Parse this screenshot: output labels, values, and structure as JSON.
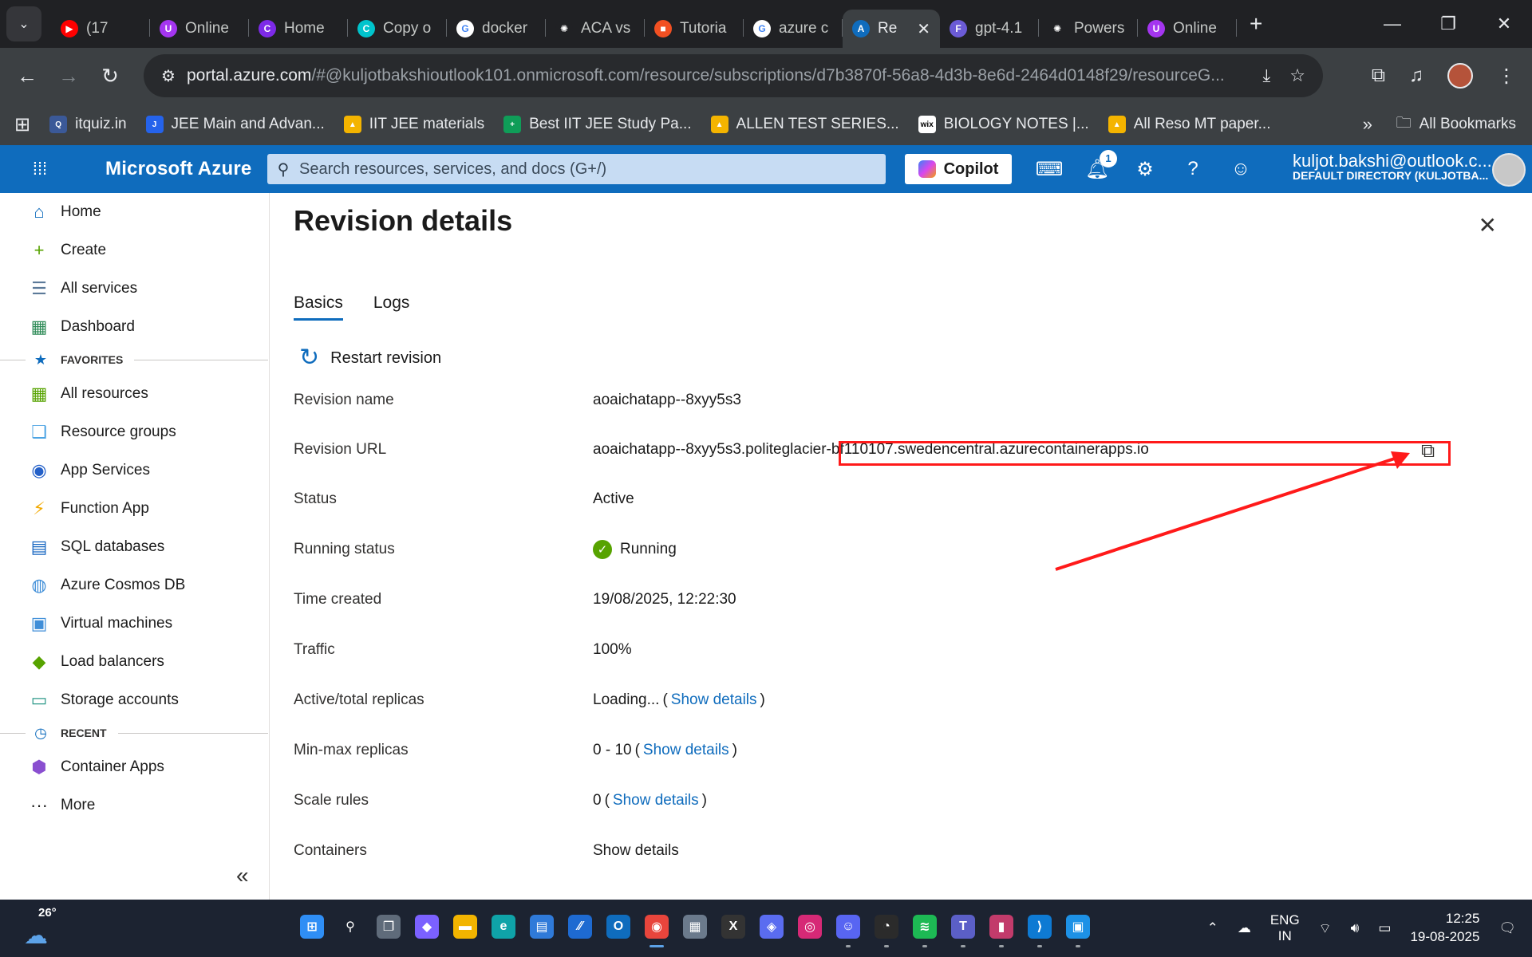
{
  "browser": {
    "tabs": [
      {
        "title": "(17",
        "icon": "youtube-icon",
        "color": "#ff0000",
        "glyph": "▶"
      },
      {
        "title": "Online",
        "icon": "udemy-icon",
        "color": "#a435f0",
        "glyph": "U"
      },
      {
        "title": "Home",
        "icon": "canva-icon",
        "color": "#7d2ae8",
        "glyph": "C"
      },
      {
        "title": "Copy o",
        "icon": "canva-icon",
        "color": "#00c4cc",
        "glyph": "C"
      },
      {
        "title": "docker",
        "icon": "google-icon",
        "color": "#ffffff",
        "glyph": "G"
      },
      {
        "title": "ACA vs",
        "icon": "chatgpt-icon",
        "color": "#202124",
        "glyph": "✺"
      },
      {
        "title": "Tutoria",
        "icon": "microsoft-icon",
        "color": "#f25022",
        "glyph": "■"
      },
      {
        "title": "azure c",
        "icon": "google-icon",
        "color": "#ffffff",
        "glyph": "G"
      },
      {
        "title": "Re",
        "icon": "azure-icon",
        "color": "#0f6cbd",
        "glyph": "A",
        "active": true
      },
      {
        "title": "gpt-4.1",
        "icon": "foundry-icon",
        "color": "#6b5bd6",
        "glyph": "F"
      },
      {
        "title": "Powers",
        "icon": "chatgpt-icon",
        "color": "#202124",
        "glyph": "✺"
      },
      {
        "title": "Online",
        "icon": "udemy-icon",
        "color": "#a435f0",
        "glyph": "U"
      }
    ],
    "url_host": "portal.azure.com",
    "url_path": "/#@kuljotbakshioutlook101.onmicrosoft.com/resource/subscriptions/d7b3870f-56a8-4d3b-8e6d-2464d0148f29/resourceG...",
    "bookmarks": [
      {
        "label": "itquiz.in",
        "color": "#3b5998",
        "glyph": "Q"
      },
      {
        "label": "JEE Main and Advan...",
        "color": "#2563eb",
        "glyph": "J"
      },
      {
        "label": "IIT JEE materials",
        "color": "#f4b400",
        "glyph": "▲"
      },
      {
        "label": "Best IIT JEE Study Pa...",
        "color": "#0f9d58",
        "glyph": "+"
      },
      {
        "label": "ALLEN TEST SERIES...",
        "color": "#f4b400",
        "glyph": "▲"
      },
      {
        "label": "BIOLOGY NOTES |...",
        "color": "#ffffff",
        "glyph": "wix"
      },
      {
        "label": "All Reso MT paper...",
        "color": "#f4b400",
        "glyph": "▲"
      }
    ],
    "all_bookmarks": "All Bookmarks"
  },
  "azure": {
    "brand": "Microsoft Azure",
    "search_placeholder": "Search resources, services, and docs (G+/)",
    "copilot_label": "Copilot",
    "notification_count": "1",
    "user_email": "kuljot.bakshi@outlook.c...",
    "user_directory": "DEFAULT DIRECTORY (KULJOTBA..."
  },
  "sidebar": {
    "items": [
      {
        "label": "Home",
        "icon": "home-icon"
      },
      {
        "label": "Create",
        "icon": "plus-icon"
      },
      {
        "label": "All services",
        "icon": "list-icon"
      },
      {
        "label": "Dashboard",
        "icon": "dashboard-icon"
      }
    ],
    "favorites_label": "FAVORITES",
    "favorites": [
      {
        "label": "All resources",
        "icon": "grid-icon"
      },
      {
        "label": "Resource groups",
        "icon": "resource-group-icon"
      },
      {
        "label": "App Services",
        "icon": "app-services-icon"
      },
      {
        "label": "Function App",
        "icon": "function-icon"
      },
      {
        "label": "SQL databases",
        "icon": "sql-icon"
      },
      {
        "label": "Azure Cosmos DB",
        "icon": "cosmos-icon"
      },
      {
        "label": "Virtual machines",
        "icon": "vm-icon"
      },
      {
        "label": "Load balancers",
        "icon": "load-balancer-icon"
      },
      {
        "label": "Storage accounts",
        "icon": "storage-icon"
      }
    ],
    "recent_label": "RECENT",
    "recent": [
      {
        "label": "Container Apps",
        "icon": "container-apps-icon"
      }
    ],
    "more_label": "More"
  },
  "blade": {
    "title": "Revision details",
    "tabs": [
      "Basics",
      "Logs"
    ],
    "command": "Restart revision",
    "fields": {
      "revision_name": {
        "label": "Revision name",
        "value": "aoaichatapp--8xyy5s3"
      },
      "revision_url": {
        "label": "Revision URL",
        "value": "aoaichatapp--8xyy5s3.politeglacier-bf110107.swedencentral.azurecontainerapps.io"
      },
      "status": {
        "label": "Status",
        "value": "Active"
      },
      "running_status": {
        "label": "Running status",
        "value": "Running"
      },
      "time_created": {
        "label": "Time created",
        "value": "19/08/2025, 12:22:30"
      },
      "traffic": {
        "label": "Traffic",
        "value": "100%"
      },
      "replicas": {
        "label": "Active/total replicas",
        "value": "Loading...",
        "link": "Show details"
      },
      "minmax": {
        "label": "Min-max replicas",
        "value": "0 - 10",
        "link": "Show details"
      },
      "scale_rules": {
        "label": "Scale rules",
        "value": "0",
        "link": "Show details"
      },
      "containers": {
        "label": "Containers",
        "link": "Show details"
      }
    }
  },
  "taskbar": {
    "temperature": "26°",
    "lang_top": "ENG",
    "lang_bottom": "IN",
    "time": "12:25",
    "date": "19-08-2025"
  },
  "colors": {
    "azure_blue": "#0f6cbd",
    "running_green": "#57a300",
    "annotation_red": "#ff1a1a"
  }
}
